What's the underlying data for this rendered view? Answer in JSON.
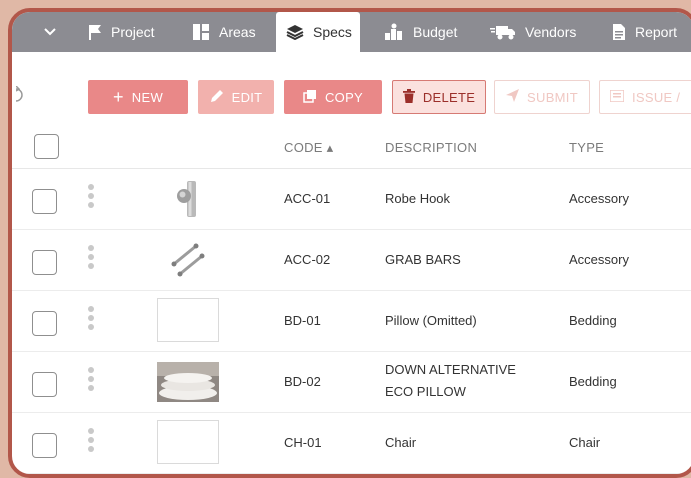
{
  "nav": {
    "items": [
      {
        "label": "Project",
        "icon": "flag-icon"
      },
      {
        "label": "Areas",
        "icon": "areas-icon"
      },
      {
        "label": "Specs",
        "icon": "layers-icon",
        "active": true
      },
      {
        "label": "Budget",
        "icon": "budget-icon"
      },
      {
        "label": "Vendors",
        "icon": "truck-icon"
      },
      {
        "label": "Report",
        "icon": "document-icon"
      }
    ]
  },
  "toolbar": {
    "new_label": "NEW",
    "edit_label": "EDIT",
    "copy_label": "COPY",
    "delete_label": "DELETE",
    "submit_label": "SUBMIT",
    "issue_label": "ISSUE /"
  },
  "table": {
    "columns": {
      "code": "CODE ▴",
      "description": "DESCRIPTION",
      "type": "TYPE"
    },
    "rows": [
      {
        "code": "ACC-01",
        "description": "Robe Hook",
        "type": "Accessory",
        "thumb": "robe-hook"
      },
      {
        "code": "ACC-02",
        "description": "GRAB BARS",
        "type": "Accessory",
        "thumb": "grab-bars"
      },
      {
        "code": "BD-01",
        "description": "Pillow (Omitted)",
        "type": "Bedding",
        "thumb": "empty"
      },
      {
        "code": "BD-02",
        "description": "DOWN ALTERNATIVE ECO PILLOW",
        "type": "Bedding",
        "thumb": "pillows"
      },
      {
        "code": "CH-01",
        "description": "Chair",
        "type": "Chair",
        "thumb": "empty"
      }
    ]
  },
  "colors": {
    "accent": "#e98888",
    "nav_bg": "#8c8c92",
    "frame": "#b2574a",
    "background": "#e0b8a6"
  }
}
